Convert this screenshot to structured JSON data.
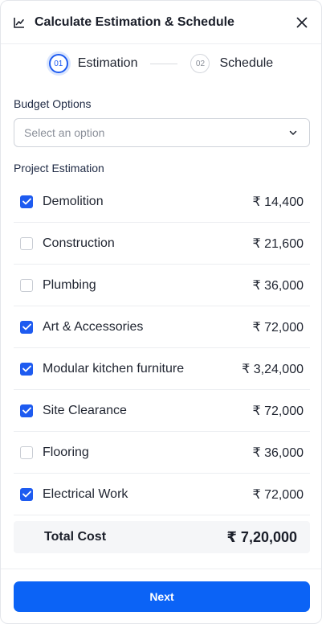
{
  "header": {
    "title": "Calculate Estimation & Schedule",
    "icon": "chart-line-icon"
  },
  "stepper": {
    "steps": [
      {
        "number": "01",
        "label": "Estimation",
        "active": true
      },
      {
        "number": "02",
        "label": "Schedule",
        "active": false
      }
    ]
  },
  "budget": {
    "label": "Budget Options",
    "placeholder": "Select an option"
  },
  "estimation": {
    "label": "Project Estimation",
    "items": [
      {
        "label": "Demolition",
        "amount": "₹ 14,400",
        "checked": true
      },
      {
        "label": "Construction",
        "amount": "₹ 21,600",
        "checked": false
      },
      {
        "label": "Plumbing",
        "amount": "₹ 36,000",
        "checked": false
      },
      {
        "label": "Art & Accessories",
        "amount": "₹ 72,000",
        "checked": true
      },
      {
        "label": "Modular kitchen furniture",
        "amount": "₹ 3,24,000",
        "checked": true
      },
      {
        "label": "Site Clearance",
        "amount": "₹ 72,000",
        "checked": true
      },
      {
        "label": "Flooring",
        "amount": "₹ 36,000",
        "checked": false
      },
      {
        "label": "Electrical Work",
        "amount": "₹ 72,000",
        "checked": true
      }
    ],
    "total_label": "Total Cost",
    "total_value": "₹ 7,20,000"
  },
  "footer": {
    "next_label": "Next"
  },
  "colors": {
    "accent": "#1e5bf0",
    "button": "#0b63f6"
  }
}
